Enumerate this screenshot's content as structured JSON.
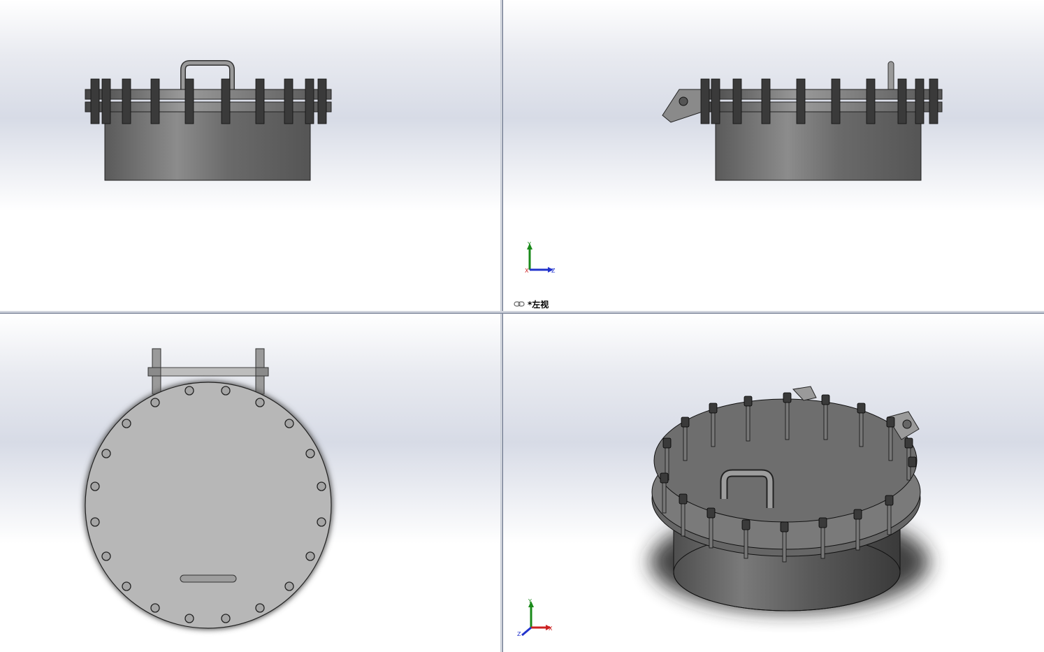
{
  "viewports": {
    "top_left": {
      "name": "front-view"
    },
    "top_right": {
      "name": "left-view",
      "label": "*左视"
    },
    "bottom_left": {
      "name": "top-view"
    },
    "bottom_right": {
      "name": "isometric-view"
    }
  },
  "triads": {
    "left_view": {
      "axis_y": "Y",
      "axis_z": "Z",
      "axis_x": "X"
    },
    "isometric": {
      "axis_y": "Y",
      "axis_z": "Z",
      "axis_x": "X"
    }
  },
  "colors": {
    "body_dark": "#555555",
    "body_mid": "#8a8a8a",
    "plate_light": "#b5b5b5",
    "axis_y": "#1a8a1a",
    "axis_z": "#2233cc",
    "axis_x": "#cc2222"
  }
}
